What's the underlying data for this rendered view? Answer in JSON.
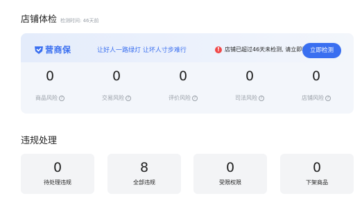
{
  "health": {
    "title": "店铺体检",
    "note": "检测时间: 46天前",
    "brand": "营商保",
    "slogan": "让好人一路绿灯 让坏人寸步难行",
    "warning": "店铺已超过46天未检测, 请立即检测",
    "detect_button": "立即检测",
    "risks": [
      {
        "value": "0",
        "label": "商品风险"
      },
      {
        "value": "0",
        "label": "交易风险"
      },
      {
        "value": "0",
        "label": "评价风险"
      },
      {
        "value": "0",
        "label": "司法风险"
      },
      {
        "value": "0",
        "label": "店铺风险"
      }
    ]
  },
  "violations": {
    "title": "违规处理",
    "items": [
      {
        "value": "0",
        "label": "待处理违规"
      },
      {
        "value": "8",
        "label": "全部违规"
      },
      {
        "value": "0",
        "label": "受限权限"
      },
      {
        "value": "0",
        "label": "下架商品"
      }
    ]
  },
  "colors": {
    "accent": "#3a6ff0",
    "warning": "#f04848",
    "card_bg": "#f3f6fb"
  }
}
